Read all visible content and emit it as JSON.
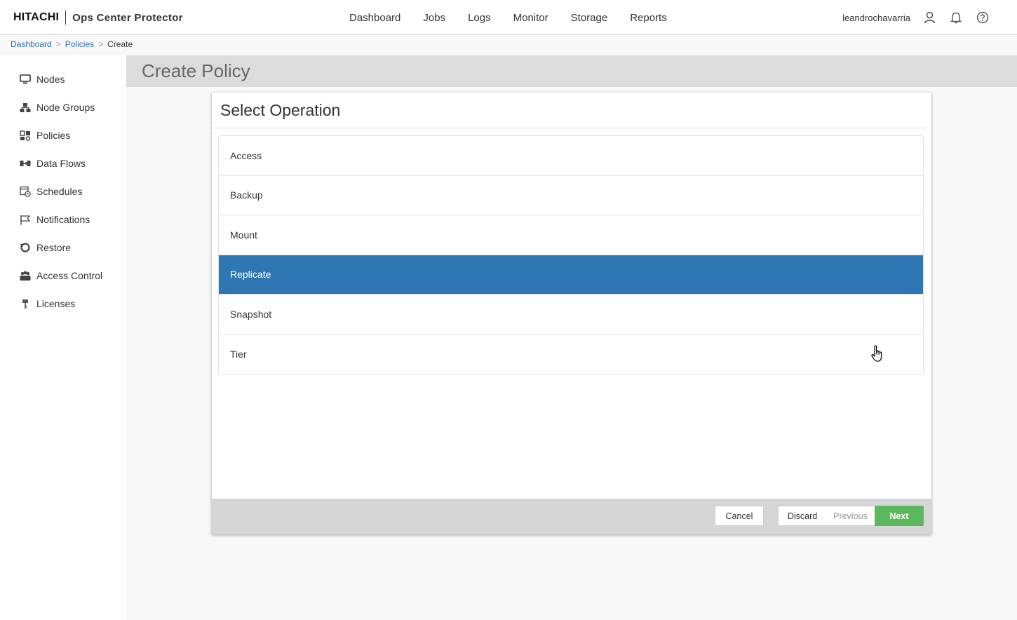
{
  "header": {
    "brand_logo": "HITACHI",
    "brand_product": "Ops Center Protector",
    "nav": [
      "Dashboard",
      "Jobs",
      "Logs",
      "Monitor",
      "Storage",
      "Reports"
    ],
    "username": "leandrochavarria",
    "icons": [
      "user-icon",
      "bell-icon",
      "help-icon"
    ]
  },
  "breadcrumb": {
    "items": [
      "Dashboard",
      "Policies"
    ],
    "separator": ">",
    "current": "Create"
  },
  "sidebar": {
    "items": [
      {
        "label": "Nodes",
        "icon": "monitor-icon"
      },
      {
        "label": "Node Groups",
        "icon": "node-groups-icon"
      },
      {
        "label": "Policies",
        "icon": "policies-icon"
      },
      {
        "label": "Data Flows",
        "icon": "data-flows-icon"
      },
      {
        "label": "Schedules",
        "icon": "schedules-icon"
      },
      {
        "label": "Notifications",
        "icon": "flag-icon"
      },
      {
        "label": "Restore",
        "icon": "restore-icon"
      },
      {
        "label": "Access Control",
        "icon": "users-icon"
      },
      {
        "label": "Licenses",
        "icon": "license-icon"
      }
    ]
  },
  "page": {
    "title": "Create Policy"
  },
  "wizard": {
    "title": "Select Operation",
    "operations": [
      "Access",
      "Backup",
      "Mount",
      "Replicate",
      "Snapshot",
      "Tier"
    ],
    "selected": "Replicate",
    "buttons": {
      "cancel": "Cancel",
      "discard": "Discard",
      "previous": "Previous",
      "next": "Next"
    }
  },
  "colors": {
    "selected_row": "#2f77b4",
    "next_button": "#5cb85c",
    "link": "#2f6eb3",
    "title_strip": "#dcdcdc"
  }
}
